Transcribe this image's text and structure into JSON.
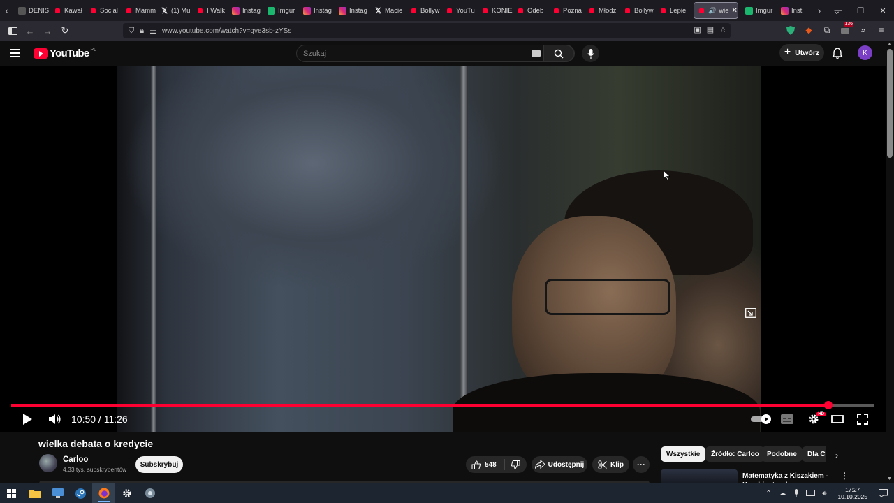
{
  "browser": {
    "tabs": [
      {
        "label": "DENIS",
        "favicon": "generic"
      },
      {
        "label": "Kawał",
        "favicon": "youtube"
      },
      {
        "label": "Social",
        "favicon": "youtube"
      },
      {
        "label": "Mamm",
        "favicon": "youtube"
      },
      {
        "label": "(1) Mu",
        "favicon": "x"
      },
      {
        "label": "I Walk",
        "favicon": "youtube"
      },
      {
        "label": "Instag",
        "favicon": "instagram"
      },
      {
        "label": "Imgur",
        "favicon": "imgur"
      },
      {
        "label": "Instag",
        "favicon": "instagram"
      },
      {
        "label": "Instag",
        "favicon": "instagram"
      },
      {
        "label": "Macie",
        "favicon": "x"
      },
      {
        "label": "Bollyw",
        "favicon": "youtube"
      },
      {
        "label": "YouTu",
        "favicon": "youtube"
      },
      {
        "label": "KONIE",
        "favicon": "youtube"
      },
      {
        "label": "Odeb",
        "favicon": "youtube"
      },
      {
        "label": "Pozna",
        "favicon": "youtube"
      },
      {
        "label": "Młodz",
        "favicon": "youtube"
      },
      {
        "label": "Bollyw",
        "favicon": "youtube"
      },
      {
        "label": "Lepie",
        "favicon": "youtube"
      },
      {
        "label": "wie",
        "favicon": "youtube",
        "active": true,
        "audio": "🔊"
      },
      {
        "label": "Imgur",
        "favicon": "imgur"
      },
      {
        "label": "Inst",
        "favicon": "instagram"
      }
    ],
    "url": "www.youtube.com/watch?v=gve3sb-zYSs",
    "extension_badge": "136",
    "accent": "#ff0033"
  },
  "yt": {
    "logo_word": "YouTube",
    "country_code": "PL",
    "search_placeholder": "Szukaj",
    "create_label": "Utwórz",
    "avatar_letter": "K"
  },
  "player": {
    "current_time": "10:50",
    "duration": "11:26",
    "time_display": "10:50 / 11:26",
    "progress_fraction": 0.947,
    "hd_label": "HD"
  },
  "video": {
    "title": "wielka debata o kredycie",
    "channel": "Carloo",
    "subscribers": "4,33 tys. subskrybentów",
    "subscribe_label": "Subskrybuj",
    "likes": "548",
    "share_label": "Udostępnij",
    "clip_label": "Klip",
    "more_label": "···"
  },
  "chips": [
    "Wszystkie",
    "Źródło: Carloo",
    "Podobne",
    "Dla C"
  ],
  "recommendation": {
    "title": "Matematyka z Kiszakiem - Kombinatoryka"
  },
  "taskbar": {
    "time": "17:27",
    "date": "10.10.2025"
  }
}
